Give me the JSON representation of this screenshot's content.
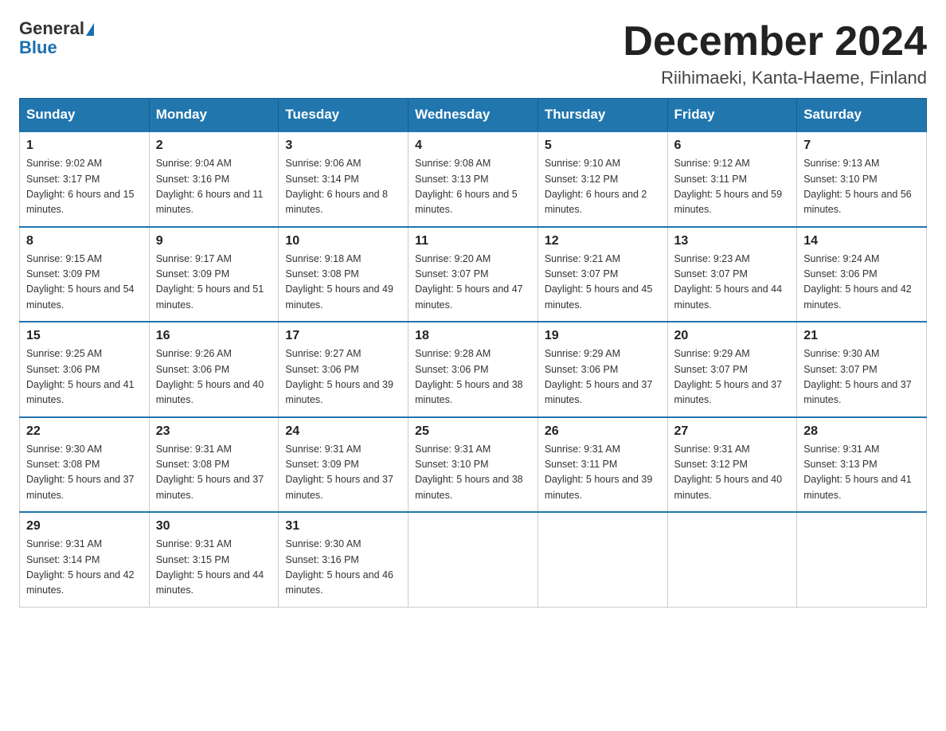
{
  "header": {
    "logo": {
      "line1": "General",
      "line2": "Blue"
    },
    "title": "December 2024",
    "location": "Riihimaeki, Kanta-Haeme, Finland"
  },
  "days_of_week": [
    "Sunday",
    "Monday",
    "Tuesday",
    "Wednesday",
    "Thursday",
    "Friday",
    "Saturday"
  ],
  "weeks": [
    [
      {
        "day": "1",
        "sunrise": "9:02 AM",
        "sunset": "3:17 PM",
        "daylight": "6 hours and 15 minutes."
      },
      {
        "day": "2",
        "sunrise": "9:04 AM",
        "sunset": "3:16 PM",
        "daylight": "6 hours and 11 minutes."
      },
      {
        "day": "3",
        "sunrise": "9:06 AM",
        "sunset": "3:14 PM",
        "daylight": "6 hours and 8 minutes."
      },
      {
        "day": "4",
        "sunrise": "9:08 AM",
        "sunset": "3:13 PM",
        "daylight": "6 hours and 5 minutes."
      },
      {
        "day": "5",
        "sunrise": "9:10 AM",
        "sunset": "3:12 PM",
        "daylight": "6 hours and 2 minutes."
      },
      {
        "day": "6",
        "sunrise": "9:12 AM",
        "sunset": "3:11 PM",
        "daylight": "5 hours and 59 minutes."
      },
      {
        "day": "7",
        "sunrise": "9:13 AM",
        "sunset": "3:10 PM",
        "daylight": "5 hours and 56 minutes."
      }
    ],
    [
      {
        "day": "8",
        "sunrise": "9:15 AM",
        "sunset": "3:09 PM",
        "daylight": "5 hours and 54 minutes."
      },
      {
        "day": "9",
        "sunrise": "9:17 AM",
        "sunset": "3:09 PM",
        "daylight": "5 hours and 51 minutes."
      },
      {
        "day": "10",
        "sunrise": "9:18 AM",
        "sunset": "3:08 PM",
        "daylight": "5 hours and 49 minutes."
      },
      {
        "day": "11",
        "sunrise": "9:20 AM",
        "sunset": "3:07 PM",
        "daylight": "5 hours and 47 minutes."
      },
      {
        "day": "12",
        "sunrise": "9:21 AM",
        "sunset": "3:07 PM",
        "daylight": "5 hours and 45 minutes."
      },
      {
        "day": "13",
        "sunrise": "9:23 AM",
        "sunset": "3:07 PM",
        "daylight": "5 hours and 44 minutes."
      },
      {
        "day": "14",
        "sunrise": "9:24 AM",
        "sunset": "3:06 PM",
        "daylight": "5 hours and 42 minutes."
      }
    ],
    [
      {
        "day": "15",
        "sunrise": "9:25 AM",
        "sunset": "3:06 PM",
        "daylight": "5 hours and 41 minutes."
      },
      {
        "day": "16",
        "sunrise": "9:26 AM",
        "sunset": "3:06 PM",
        "daylight": "5 hours and 40 minutes."
      },
      {
        "day": "17",
        "sunrise": "9:27 AM",
        "sunset": "3:06 PM",
        "daylight": "5 hours and 39 minutes."
      },
      {
        "day": "18",
        "sunrise": "9:28 AM",
        "sunset": "3:06 PM",
        "daylight": "5 hours and 38 minutes."
      },
      {
        "day": "19",
        "sunrise": "9:29 AM",
        "sunset": "3:06 PM",
        "daylight": "5 hours and 37 minutes."
      },
      {
        "day": "20",
        "sunrise": "9:29 AM",
        "sunset": "3:07 PM",
        "daylight": "5 hours and 37 minutes."
      },
      {
        "day": "21",
        "sunrise": "9:30 AM",
        "sunset": "3:07 PM",
        "daylight": "5 hours and 37 minutes."
      }
    ],
    [
      {
        "day": "22",
        "sunrise": "9:30 AM",
        "sunset": "3:08 PM",
        "daylight": "5 hours and 37 minutes."
      },
      {
        "day": "23",
        "sunrise": "9:31 AM",
        "sunset": "3:08 PM",
        "daylight": "5 hours and 37 minutes."
      },
      {
        "day": "24",
        "sunrise": "9:31 AM",
        "sunset": "3:09 PM",
        "daylight": "5 hours and 37 minutes."
      },
      {
        "day": "25",
        "sunrise": "9:31 AM",
        "sunset": "3:10 PM",
        "daylight": "5 hours and 38 minutes."
      },
      {
        "day": "26",
        "sunrise": "9:31 AM",
        "sunset": "3:11 PM",
        "daylight": "5 hours and 39 minutes."
      },
      {
        "day": "27",
        "sunrise": "9:31 AM",
        "sunset": "3:12 PM",
        "daylight": "5 hours and 40 minutes."
      },
      {
        "day": "28",
        "sunrise": "9:31 AM",
        "sunset": "3:13 PM",
        "daylight": "5 hours and 41 minutes."
      }
    ],
    [
      {
        "day": "29",
        "sunrise": "9:31 AM",
        "sunset": "3:14 PM",
        "daylight": "5 hours and 42 minutes."
      },
      {
        "day": "30",
        "sunrise": "9:31 AM",
        "sunset": "3:15 PM",
        "daylight": "5 hours and 44 minutes."
      },
      {
        "day": "31",
        "sunrise": "9:30 AM",
        "sunset": "3:16 PM",
        "daylight": "5 hours and 46 minutes."
      },
      null,
      null,
      null,
      null
    ]
  ]
}
